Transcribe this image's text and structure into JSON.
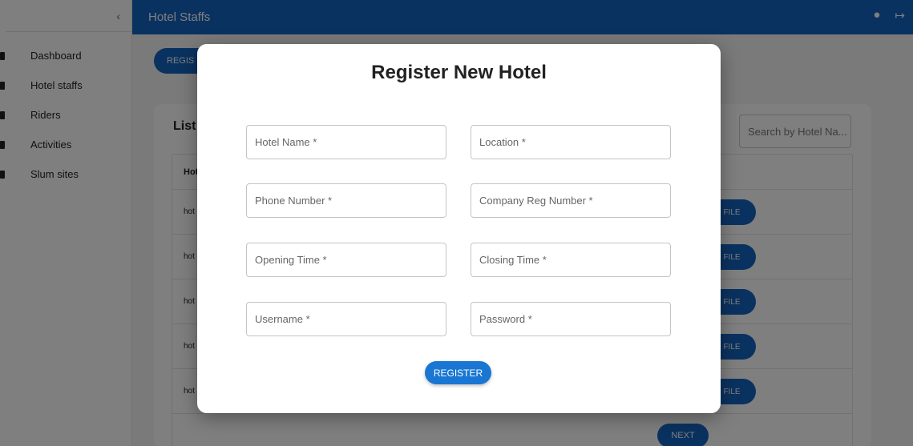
{
  "sidebar": {
    "collapse_icon": "chevron-left-icon",
    "collapse_glyph": "‹",
    "items": [
      {
        "label": "Dashboard",
        "icon": "dashboard-icon"
      },
      {
        "label": "Hotel staffs",
        "icon": "hotel-icon"
      },
      {
        "label": "Riders",
        "icon": "riders-icon"
      },
      {
        "label": "Activities",
        "icon": "activities-icon"
      },
      {
        "label": "Slum sites",
        "icon": "slum-sites-icon"
      }
    ]
  },
  "header": {
    "title": "Hotel Staffs",
    "account_icon": "account-circle-icon",
    "logout_icon": "logout-icon",
    "account_glyph": "●",
    "logout_glyph": "↦"
  },
  "main": {
    "register_button_partial": "REGIS",
    "card_title_partial": "List",
    "search_placeholder": "Search by Hotel Na...",
    "table_header_partial": "Hot",
    "row_cell_partial": "hot",
    "profile_button_partial": "FILE",
    "next_label": "NEXT"
  },
  "modal": {
    "title": "Register New Hotel",
    "fields": {
      "hotel_name": "Hotel Name *",
      "location": "Location *",
      "phone_number": "Phone Number *",
      "company_reg_number": "Company Reg Number *",
      "opening_time": "Opening Time *",
      "closing_time": "Closing Time *",
      "username": "Username *",
      "password": "Password *"
    },
    "submit_label": "REGISTER"
  },
  "colors": {
    "primary": "#1565c0",
    "button": "#1976d2",
    "backdrop": "rgba(0,0,0,0.5)"
  }
}
